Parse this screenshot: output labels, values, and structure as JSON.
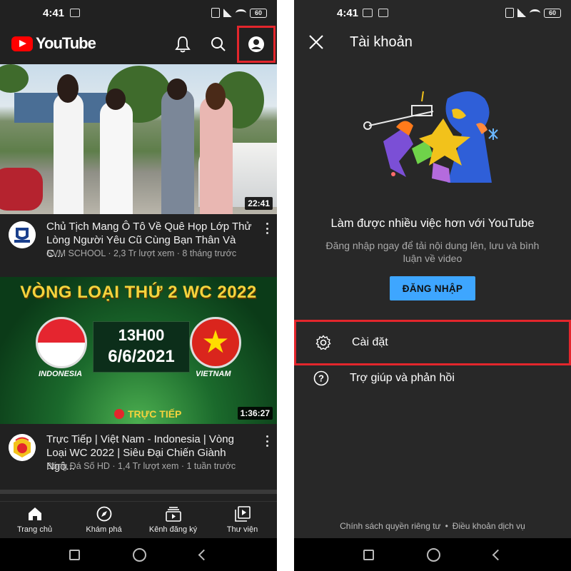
{
  "left_screen": {
    "status_bar": {
      "time": "4:41",
      "battery": "60",
      "app_badge": "Zalo"
    },
    "app_bar": {
      "logo_text": "YouTube",
      "icons": [
        "bell-icon",
        "search-icon",
        "account-icon"
      ]
    },
    "videos": [
      {
        "duration": "22:41",
        "title": "Chủ Tịch Mang Ô Tô Về Quê Họp Lớp Thử Lòng Người Yêu Cũ Cùng Bạn Thân Và C...",
        "channel": "SVM SCHOOL",
        "views": "2,3 Tr lượt xem",
        "age": "8 tháng trước",
        "meta": "SVM SCHOOL · 2,3 Tr lượt xem · 8 tháng trước"
      },
      {
        "duration": "1:36:27",
        "title": "Trực Tiếp | Việt Nam - Indonesia | Vòng Loại WC 2022 | Siêu Đại Chiến Giành Ngô...",
        "channel": "Bóng Đá Số HD",
        "views": "1,4 Tr lượt xem",
        "age": "1 tuần trước",
        "meta": "Bóng Đá Số HD · 1,4 Tr lượt xem · 1 tuần trước",
        "thumb": {
          "headline": "VÒNG LOẠI THỨ 2 WC 2022",
          "time": "13H00",
          "date": "6/6/2021",
          "team_left": "INDONESIA",
          "team_right": "VIETNAM",
          "live": "TRỰC TIẾP"
        }
      }
    ],
    "bottom_nav": [
      {
        "label": "Trang chủ",
        "icon": "home-icon"
      },
      {
        "label": "Khám phá",
        "icon": "explore-icon"
      },
      {
        "label": "Kênh đăng ký",
        "icon": "subscriptions-icon"
      },
      {
        "label": "Thư viện",
        "icon": "library-icon"
      }
    ]
  },
  "right_screen": {
    "status_bar": {
      "time": "4:41",
      "battery": "60",
      "app_badge": "Zalo"
    },
    "header": {
      "title": "Tài khoản"
    },
    "promo": {
      "title": "Làm được nhiều việc hơn với YouTube",
      "text": "Đăng nhập ngay để tải nội dung lên, lưu và bình luận về video",
      "button": "ĐĂNG NHẬP"
    },
    "menu": [
      {
        "label": "Cài đặt",
        "icon": "gear-icon"
      },
      {
        "label": "Trợ giúp và phản hồi",
        "icon": "help-icon"
      }
    ],
    "footer": {
      "privacy": "Chính sách quyền riêng tư",
      "separator": "•",
      "terms": "Điều khoản dịch vụ"
    }
  },
  "colors": {
    "highlight": "#e3262c",
    "yt_red": "#ff0000",
    "signin_blue": "#3ea6ff",
    "bg_dark": "#212121"
  }
}
